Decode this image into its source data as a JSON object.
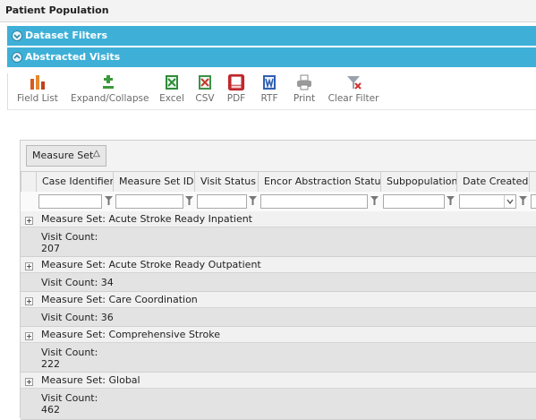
{
  "page": {
    "title": "Patient Population"
  },
  "sections": {
    "dataset_filters": "Dataset Filters",
    "abstracted_visits": "Abstracted Visits"
  },
  "toolbar": {
    "field_list": "Field List",
    "expand_collapse": "Expand/Collapse",
    "excel": "Excel",
    "csv": "CSV",
    "pdf": "PDF",
    "rtf": "RTF",
    "print": "Print",
    "clear_filter": "Clear Filter"
  },
  "grid": {
    "group_button": "Measure Set",
    "sort_glyph": "△",
    "columns": [
      "Case Identifier",
      "Measure Set ID",
      "Visit Status",
      "Encor Abstraction Status",
      "Subpopulation",
      "Date Created",
      "D"
    ],
    "groups": [
      {
        "label": "Measure Set: Acute Stroke Ready Inpatient",
        "count": "Visit Count: 207"
      },
      {
        "label": "Measure Set: Acute Stroke Ready Outpatient",
        "count": "Visit Count: 34"
      },
      {
        "label": "Measure Set: Care Coordination",
        "count": "Visit Count: 36"
      },
      {
        "label": "Measure Set: Comprehensive Stroke",
        "count": "Visit Count: 222"
      },
      {
        "label": "Measure Set: Global",
        "count": "Visit Count: 462"
      }
    ]
  },
  "colors": {
    "section_bar": "#3eb0d8",
    "pdf_red": "#c0282d",
    "excel_green": "#2e8b3a"
  }
}
